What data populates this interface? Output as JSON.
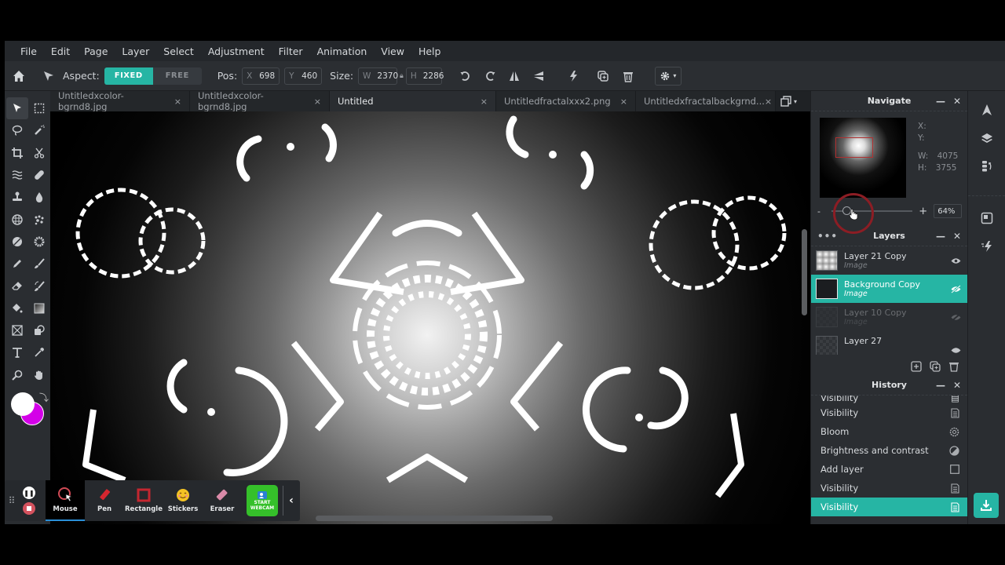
{
  "menu": [
    "File",
    "Edit",
    "Page",
    "Layer",
    "Select",
    "Adjustment",
    "Filter",
    "Animation",
    "View",
    "Help"
  ],
  "toolbar": {
    "aspect_label": "Aspect:",
    "aspect_fixed": "FIXED",
    "aspect_free": "FREE",
    "aspect_selected": "FIXED",
    "pos_label": "Pos:",
    "pos_x_key": "X",
    "pos_x": "698",
    "pos_y_key": "Y",
    "pos_y": "460",
    "size_label": "Size:",
    "size_w_key": "W",
    "size_w": "2370",
    "size_h_key": "H",
    "size_h": "2286",
    "icons": [
      "home-icon",
      "move-arrow-icon",
      "rotate-left-icon",
      "rotate-right-icon",
      "flip-horizontal-icon",
      "flip-vertical-icon",
      "quick-action-icon",
      "duplicate-icon",
      "delete-icon",
      "settings-icon"
    ]
  },
  "tabs": [
    {
      "label": "Untitledxcolor-bgrnd8.jpg",
      "active": false
    },
    {
      "label": "Untitledxcolor-bgrnd8.jpg",
      "active": false
    },
    {
      "label": "Untitled",
      "active": true
    },
    {
      "label": "Untitledfractalxxx2.png",
      "active": false
    },
    {
      "label": "Untitledxfractalbackgrnd...",
      "active": false
    }
  ],
  "tab_close": "×",
  "tools": [
    "select-arrow",
    "marquee",
    "lasso",
    "magic-wand",
    "crop",
    "cut",
    "liquify",
    "heal-bandage",
    "clone-stamp",
    "blur-drop",
    "pattern",
    "particles",
    "dodge-burn",
    "sponge",
    "pen",
    "brush",
    "eraser",
    "smart-brush",
    "paint-bucket",
    "gradient",
    "place-image",
    "shape",
    "text",
    "eyedropper",
    "zoom",
    "hand"
  ],
  "colors": {
    "foreground": "#ffffff",
    "background": "#d400e8",
    "accent": "#26b5a4"
  },
  "navigate": {
    "title": "Navigate",
    "x_label": "X:",
    "y_label": "Y:",
    "w_label": "W:",
    "w_value": "4075",
    "h_label": "H:",
    "h_value": "3755",
    "zoom_minus": "-",
    "zoom_plus": "+",
    "zoom_value": "64%",
    "zoom_fraction": 0.1
  },
  "layers": {
    "title": "Layers",
    "items": [
      {
        "name": "Layer 21 Copy",
        "type": "Image",
        "visible": true,
        "selected": false
      },
      {
        "name": "Background Copy",
        "type": "Image",
        "visible": false,
        "selected": true
      },
      {
        "name": "Layer 10 Copy",
        "type": "Image",
        "visible": false,
        "selected": false
      },
      {
        "name": "Layer 27",
        "type": "",
        "visible": true,
        "selected": false
      }
    ]
  },
  "history": {
    "title": "History",
    "items": [
      {
        "label": "Visibility",
        "icon": "document-icon",
        "partial": true
      },
      {
        "label": "Visibility",
        "icon": "document-icon"
      },
      {
        "label": "Bloom",
        "icon": "bloom-icon"
      },
      {
        "label": "Brightness and contrast",
        "icon": "contrast-icon"
      },
      {
        "label": "Add layer",
        "icon": "square-icon"
      },
      {
        "label": "Visibility",
        "icon": "document-icon"
      },
      {
        "label": "Visibility",
        "icon": "document-icon",
        "selected": true
      }
    ]
  },
  "recorder": {
    "tools": [
      {
        "label": "Mouse",
        "active": true
      },
      {
        "label": "Pen"
      },
      {
        "label": "Rectangle"
      },
      {
        "label": "Stickers"
      },
      {
        "label": "Eraser"
      }
    ],
    "webcam_line1": "START",
    "webcam_line2": "WEBCAM",
    "collapse": "‹"
  }
}
